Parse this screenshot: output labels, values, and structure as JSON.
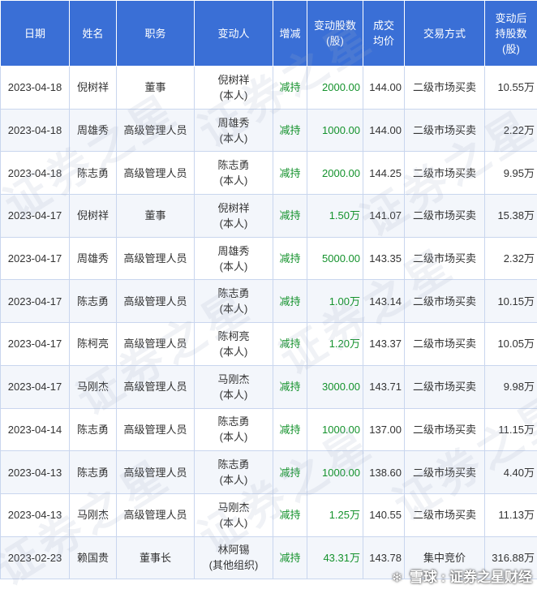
{
  "headers": {
    "date": "日期",
    "name": "姓名",
    "position": "职务",
    "changer_line1": "变动人",
    "direction": "增减",
    "shares_line1": "变动股数",
    "shares_line2": "(股)",
    "price_line1": "成交",
    "price_line2": "均价",
    "method": "交易方式",
    "after_line1": "变动后",
    "after_line2": "持股数",
    "after_line3": "(股)"
  },
  "rows": [
    {
      "date": "2023-04-18",
      "name": "倪树祥",
      "position": "董事",
      "changer": "倪树祥",
      "relation": "(本人)",
      "direction": "减持",
      "shares": "2000.00",
      "price": "144.00",
      "method": "二级市场买卖",
      "after": "10.55万"
    },
    {
      "date": "2023-04-18",
      "name": "周雄秀",
      "position": "高级管理人员",
      "changer": "周雄秀",
      "relation": "(本人)",
      "direction": "减持",
      "shares": "1000.00",
      "price": "144.00",
      "method": "二级市场买卖",
      "after": "2.22万"
    },
    {
      "date": "2023-04-18",
      "name": "陈志勇",
      "position": "高级管理人员",
      "changer": "陈志勇",
      "relation": "(本人)",
      "direction": "减持",
      "shares": "2000.00",
      "price": "144.25",
      "method": "二级市场买卖",
      "after": "9.95万"
    },
    {
      "date": "2023-04-17",
      "name": "倪树祥",
      "position": "董事",
      "changer": "倪树祥",
      "relation": "(本人)",
      "direction": "减持",
      "shares": "1.50万",
      "price": "141.07",
      "method": "二级市场买卖",
      "after": "15.38万"
    },
    {
      "date": "2023-04-17",
      "name": "周雄秀",
      "position": "高级管理人员",
      "changer": "周雄秀",
      "relation": "(本人)",
      "direction": "减持",
      "shares": "5000.00",
      "price": "143.35",
      "method": "二级市场买卖",
      "after": "2.32万"
    },
    {
      "date": "2023-04-17",
      "name": "陈志勇",
      "position": "高级管理人员",
      "changer": "陈志勇",
      "relation": "(本人)",
      "direction": "减持",
      "shares": "1.00万",
      "price": "143.14",
      "method": "二级市场买卖",
      "after": "10.15万"
    },
    {
      "date": "2023-04-17",
      "name": "陈柯亮",
      "position": "高级管理人员",
      "changer": "陈柯亮",
      "relation": "(本人)",
      "direction": "减持",
      "shares": "1.20万",
      "price": "143.37",
      "method": "二级市场买卖",
      "after": "10.05万"
    },
    {
      "date": "2023-04-17",
      "name": "马刚杰",
      "position": "高级管理人员",
      "changer": "马刚杰",
      "relation": "(本人)",
      "direction": "减持",
      "shares": "3000.00",
      "price": "143.71",
      "method": "二级市场买卖",
      "after": "9.98万"
    },
    {
      "date": "2023-04-14",
      "name": "陈志勇",
      "position": "高级管理人员",
      "changer": "陈志勇",
      "relation": "(本人)",
      "direction": "减持",
      "shares": "1000.00",
      "price": "137.00",
      "method": "二级市场买卖",
      "after": "11.15万"
    },
    {
      "date": "2023-04-13",
      "name": "陈志勇",
      "position": "高级管理人员",
      "changer": "陈志勇",
      "relation": "(本人)",
      "direction": "减持",
      "shares": "1000.00",
      "price": "138.60",
      "method": "二级市场买卖",
      "after": "4.40万"
    },
    {
      "date": "2023-04-13",
      "name": "马刚杰",
      "position": "高级管理人员",
      "changer": "马刚杰",
      "relation": "(本人)",
      "direction": "减持",
      "shares": "1.25万",
      "price": "140.55",
      "method": "二级市场买卖",
      "after": "11.13万"
    },
    {
      "date": "2023-02-23",
      "name": "赖国贵",
      "position": "董事长",
      "changer": "林阿锡",
      "relation": "(其他组织)",
      "direction": "减持",
      "shares": "43.31万",
      "price": "143.78",
      "method": "集中竞价",
      "after": "316.88万"
    }
  ],
  "watermark": "证券之星",
  "footer": {
    "brand": "雪球",
    "separator": ":",
    "source": "证券之星财经"
  },
  "colors": {
    "header_bg": "#3a6fd6",
    "decrease_text": "#14922c",
    "row_alt_bg": "#f3f6fb",
    "border": "#c9d6ee"
  },
  "icons": {
    "footer_logo": "snowball-icon"
  }
}
